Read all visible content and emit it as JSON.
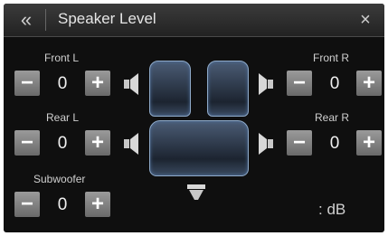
{
  "header": {
    "back_icon": "«",
    "title": "Speaker Level",
    "close_icon": "×"
  },
  "channels": {
    "front_l": {
      "label": "Front L",
      "value": "0"
    },
    "front_r": {
      "label": "Front R",
      "value": "0"
    },
    "rear_l": {
      "label": "Rear L",
      "value": "0"
    },
    "rear_r": {
      "label": "Rear R",
      "value": "0"
    },
    "subwoofer": {
      "label": "Subwoofer",
      "value": "0"
    }
  },
  "buttons": {
    "minus": "−",
    "plus": "+"
  },
  "unit": ": dB",
  "colors": {
    "background": "#0f0f0f",
    "button": "#8a8a8a",
    "seat_outline": "#8faac9"
  }
}
